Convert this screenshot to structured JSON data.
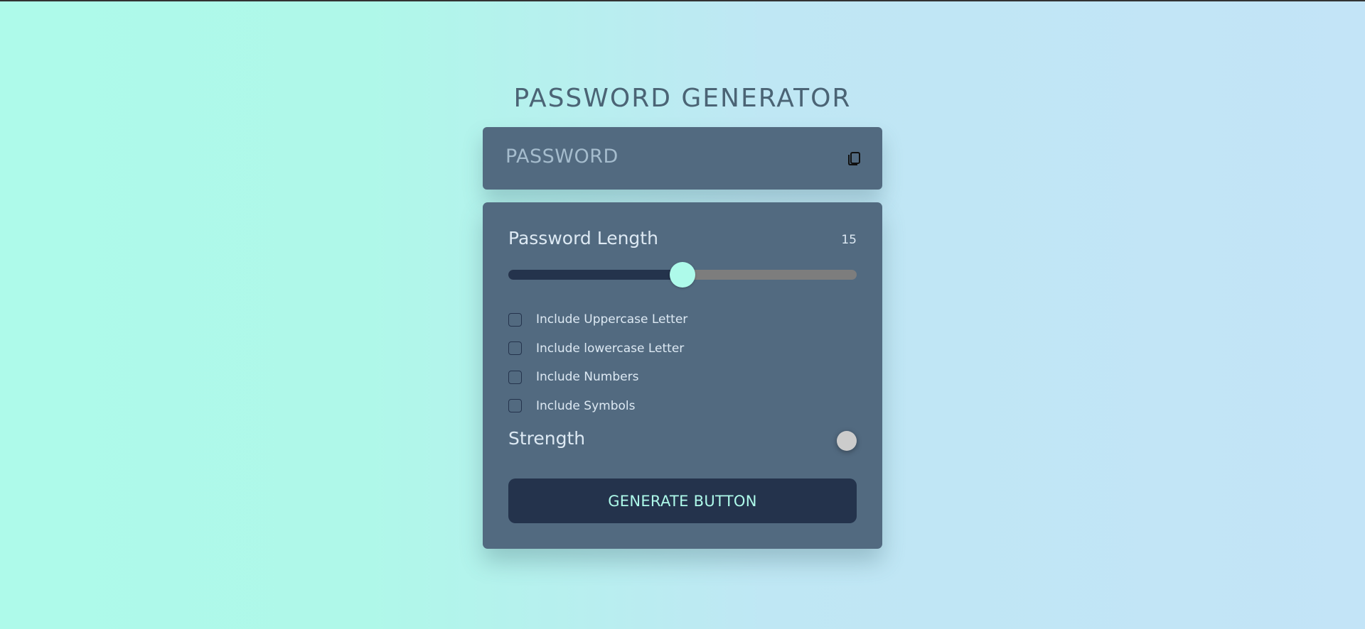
{
  "header": {
    "title": "PASSWORD GENERATOR"
  },
  "password_display": {
    "placeholder_text": "PASSWORD",
    "copy_icon": "copy-icon"
  },
  "length": {
    "label": "Password Length",
    "value": "15",
    "slider_fraction": 0.5
  },
  "options": [
    {
      "label": "Include Uppercase Letter",
      "checked": false
    },
    {
      "label": "Include lowercase Letter",
      "checked": false
    },
    {
      "label": "Include Numbers",
      "checked": false
    },
    {
      "label": "Include Symbols",
      "checked": false
    }
  ],
  "strength": {
    "label": "Strength",
    "indicator_color": "#cccccc"
  },
  "generate": {
    "label": "GENERATE BUTTON"
  },
  "colors": {
    "accent": "#aefaea",
    "card": "#526a80",
    "dark": "#24334c",
    "text": "#dde9f3"
  }
}
